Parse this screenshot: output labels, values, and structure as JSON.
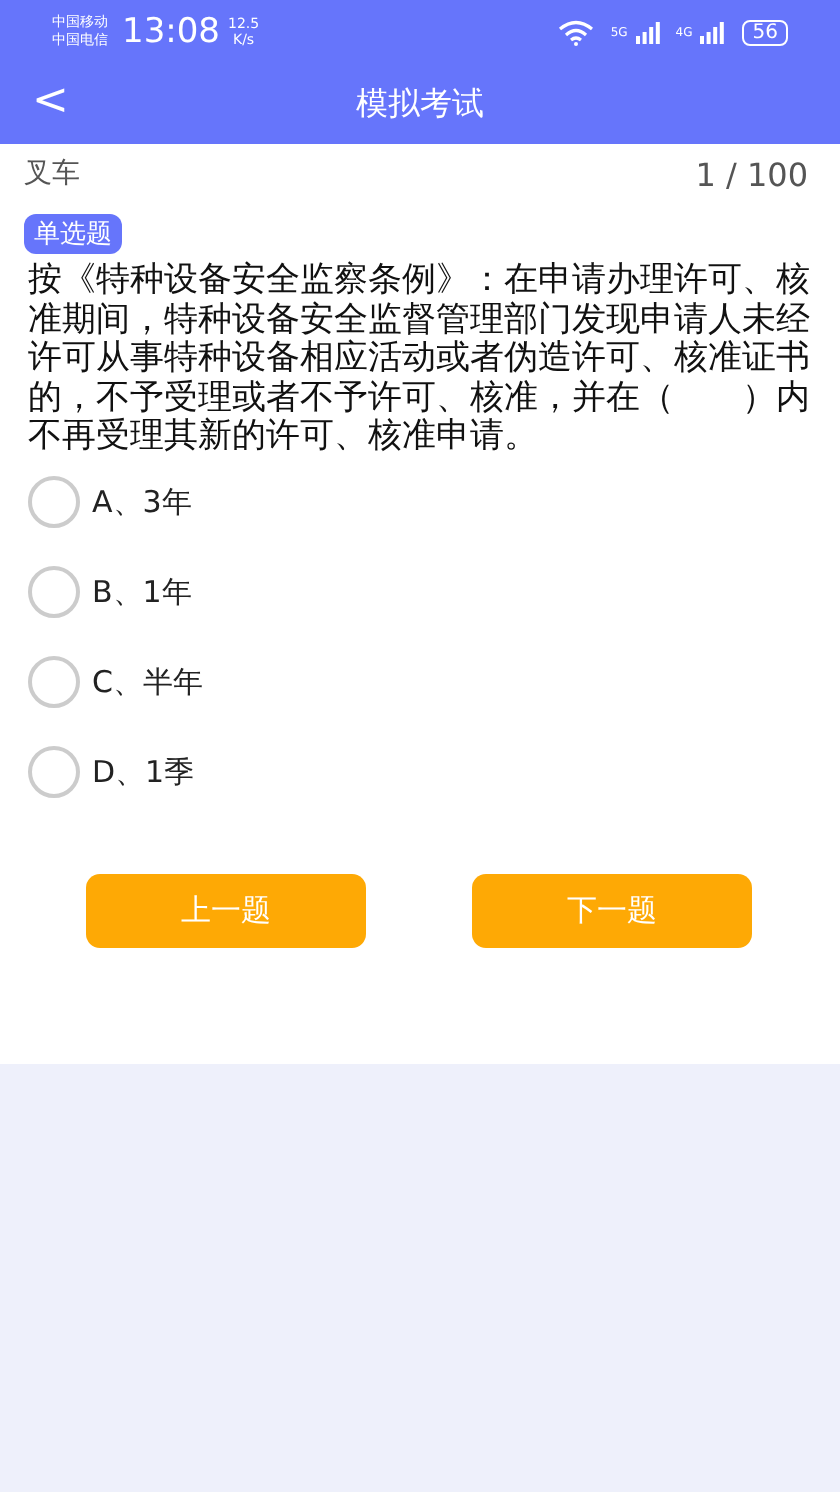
{
  "status_bar": {
    "carriers": [
      "中国移动",
      "中国电信"
    ],
    "time": "13:08",
    "speed": [
      "12.5",
      "K/s"
    ],
    "network_labels": [
      "5G",
      "4G"
    ],
    "battery": "56"
  },
  "header": {
    "back": "<",
    "title": "模拟考试"
  },
  "subheader": {
    "category": "叉车",
    "progress": "1 / 100"
  },
  "question": {
    "tag": "单选题",
    "text": "按《特种设备安全监察条例》：在申请办理许可、核准期间，特种设备安全监督管理部门发现申请人未经许可从事特种设备相应活动或者伪造许可、核准证书的，不予受理或者不予许可、核准，并在（　　）内不再受理其新的许可、核准申请。"
  },
  "options": [
    {
      "label": "A、3年",
      "selected": false
    },
    {
      "label": "B、1年",
      "selected": false
    },
    {
      "label": "C、半年",
      "selected": false
    },
    {
      "label": "D、1季",
      "selected": false
    }
  ],
  "buttons": [
    "上一题",
    "下一题"
  ]
}
